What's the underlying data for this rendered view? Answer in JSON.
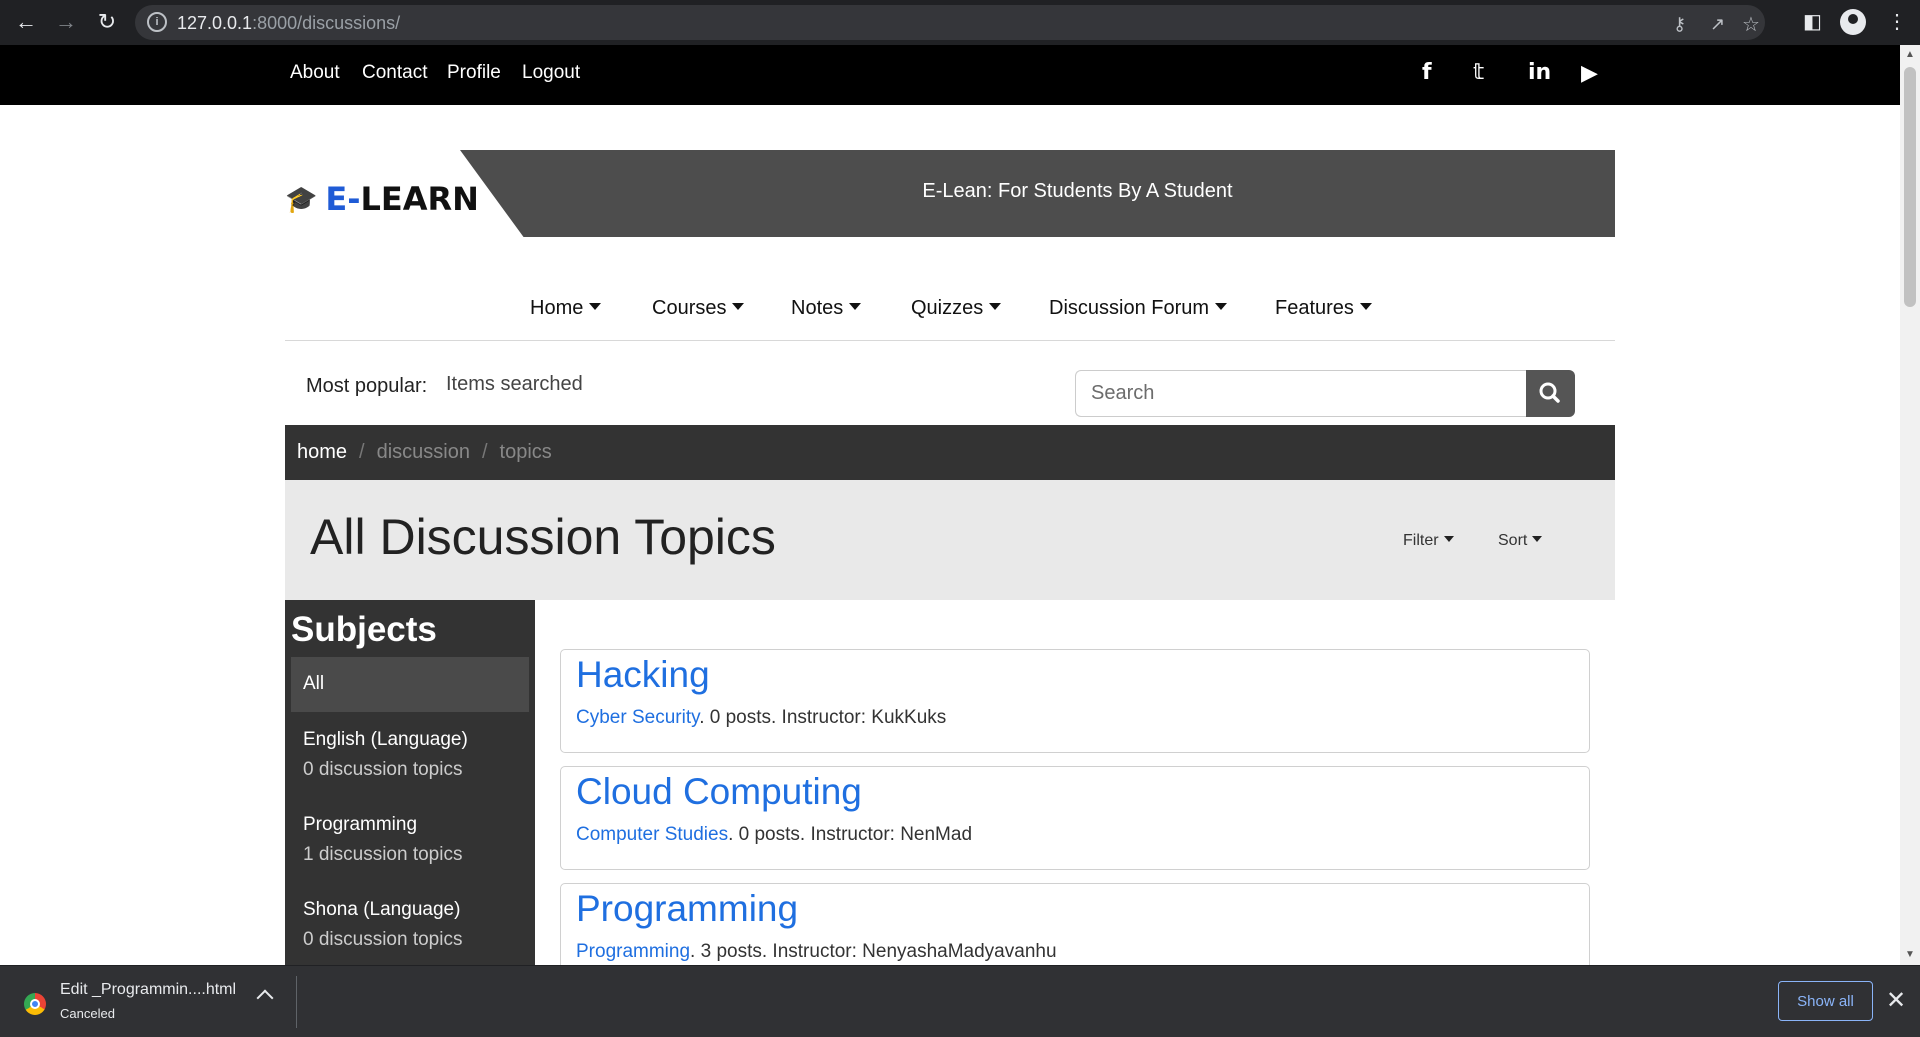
{
  "browser": {
    "url_host": "127.0.0.1",
    "url_rest": ":8000/discussions/"
  },
  "topbar": {
    "links": [
      "About",
      "Contact",
      "Profile",
      "Logout"
    ],
    "social": [
      "facebook-icon",
      "twitter-icon",
      "linkedin-icon",
      "youtube-icon"
    ]
  },
  "brand": {
    "logo_e": "E-",
    "logo_rest": "LEARN",
    "tagline": "E-Lean: For Students By A Student"
  },
  "nav": {
    "items": [
      "Home",
      "Courses",
      "Notes",
      "Quizzes",
      "Discussion Forum",
      "Features"
    ]
  },
  "popular": {
    "label": "Most popular:",
    "items": "Items searched"
  },
  "search": {
    "placeholder": "Search"
  },
  "breadcrumb": {
    "home": "home",
    "discussion": "discussion",
    "topics": "topics"
  },
  "header": {
    "title": "All Discussion Topics",
    "filter": "Filter",
    "sort": "Sort"
  },
  "sidebar": {
    "title": "Subjects",
    "items": [
      {
        "label": "All",
        "sub": ""
      },
      {
        "label": "English (Language)",
        "sub": "0 discussion topics"
      },
      {
        "label": "Programming",
        "sub": "1 discussion topics"
      },
      {
        "label": "Shona (Language)",
        "sub": "0 discussion topics"
      }
    ]
  },
  "topics": [
    {
      "title": "Hacking",
      "subject": "Cyber Security",
      "details": ". 0 posts. Instructor: KukKuks"
    },
    {
      "title": "Cloud Computing",
      "subject": "Computer Studies",
      "details": ". 0 posts. Instructor: NenMad"
    },
    {
      "title": "Programming",
      "subject": "Programming",
      "details": ". 3 posts. Instructor: NenyashaMadyavanhu"
    }
  ],
  "download": {
    "filename": "Edit _Programmin....html",
    "status": "Canceled",
    "show_all": "Show all"
  }
}
